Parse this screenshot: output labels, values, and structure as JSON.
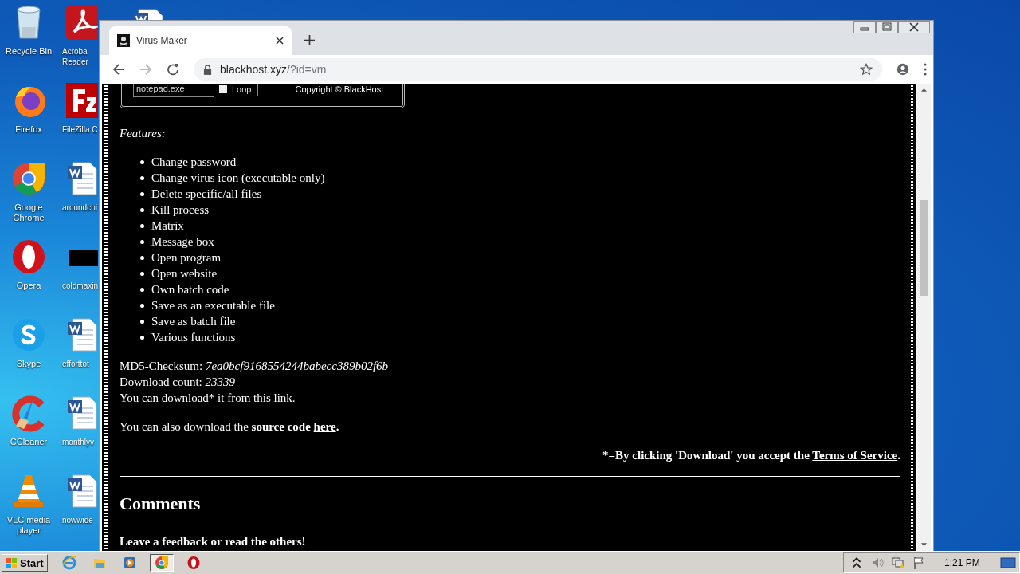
{
  "desktop": {
    "icons": [
      {
        "kind": "recycle",
        "label_lines": [
          "Recycle Bin"
        ]
      },
      {
        "kind": "firefox",
        "label_lines": [
          "Firefox"
        ]
      },
      {
        "kind": "chrome",
        "label_lines": [
          "Google",
          "Chrome"
        ]
      },
      {
        "kind": "opera",
        "label_lines": [
          "Opera"
        ]
      },
      {
        "kind": "skype",
        "label_lines": [
          "Skype"
        ]
      },
      {
        "kind": "ccleaner",
        "label_lines": [
          "CCleaner"
        ]
      },
      {
        "kind": "vlc",
        "label_lines": [
          "VLC media",
          "player"
        ]
      },
      {
        "kind": "pdf",
        "label_lines": [
          "Acroba",
          "Reader"
        ]
      },
      {
        "kind": "filezilla",
        "label_lines": [
          "FileZilla C"
        ]
      },
      {
        "kind": "word",
        "label_lines": [
          "aroundchi"
        ]
      },
      {
        "kind": "blank",
        "label_lines": [
          "coldmaxin"
        ]
      },
      {
        "kind": "word",
        "label_lines": [
          "efforttot"
        ]
      },
      {
        "kind": "word",
        "label_lines": [
          "monthlyv"
        ]
      },
      {
        "kind": "word",
        "label_lines": [
          "nowwide"
        ]
      },
      {
        "kind": "word"
      }
    ]
  },
  "browser": {
    "tabs": [
      {
        "title": "Virus Maker",
        "selected": true
      }
    ],
    "address": {
      "host": "blackhost.xyz",
      "path": "/?id=vm"
    }
  },
  "page": {
    "app_shot": {
      "field": "notepad.exe",
      "checkbox": {
        "label": "Loop",
        "checked": false
      },
      "copyright": "Copyright © BlackHost"
    },
    "features_title": "Features:",
    "features": [
      "Change password",
      "Change virus icon (executable only)",
      "Delete specific/all files",
      "Kill process",
      "Matrix",
      "Message box",
      "Open program",
      "Open website",
      "Own batch code",
      "Save as an executable file",
      "Save as batch file",
      "Various functions"
    ],
    "md5": "MD5-Checksum: *7ea0bcf9168554244babecc389b02f6b*",
    "download_count": "Download count: *23339*",
    "download_line": {
      "before": "You can download* it from ",
      "link": "this",
      "after": " link."
    },
    "source_line": {
      "before": "You can also download the **source code** ",
      "link": "here",
      "after": "."
    },
    "terms_line": {
      "before": "*=By clicking 'Download' you accept the ",
      "link": "Terms of Service",
      "after": "."
    },
    "comments_title": "Comments",
    "feedback": "Leave a feedback or read the others!"
  },
  "taskbar": {
    "start": "Start",
    "apps": [
      {
        "kind": "ie",
        "selected": false
      },
      {
        "kind": "folder",
        "selected": false
      },
      {
        "kind": "media",
        "selected": false
      },
      {
        "kind": "chrome",
        "selected": true
      },
      {
        "kind": "opera",
        "selected": false
      }
    ],
    "clock": "1:21 PM"
  }
}
